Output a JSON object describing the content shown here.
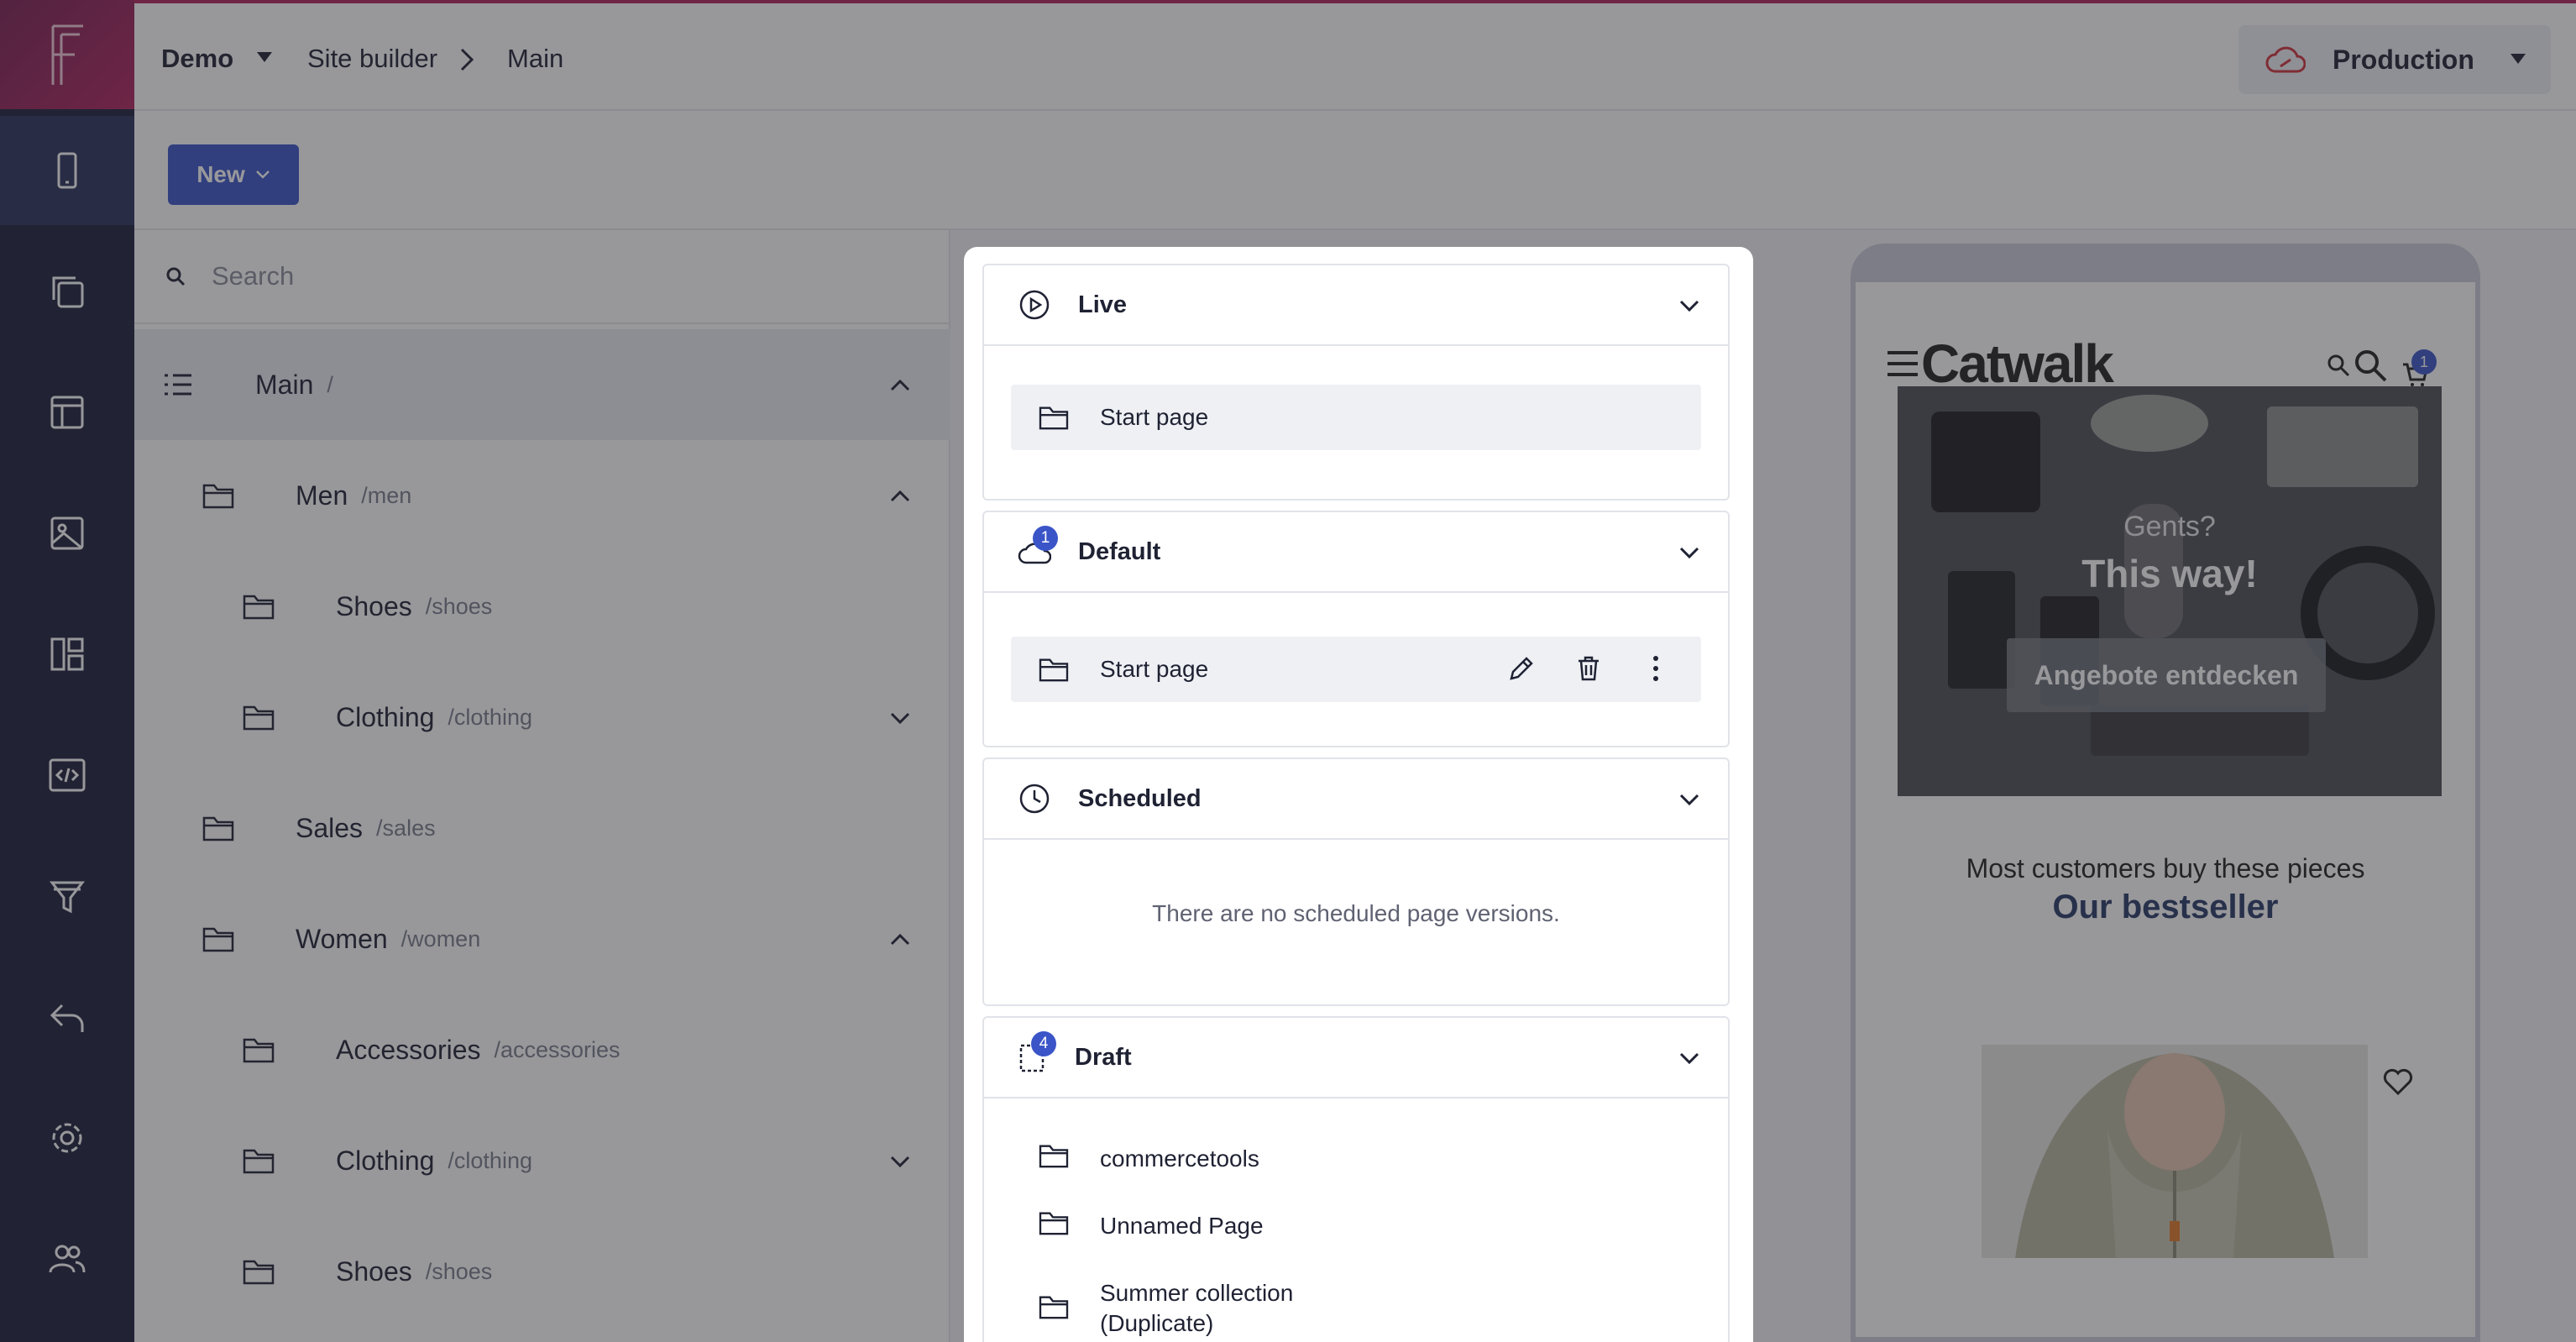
{
  "topbar": {
    "project": "Demo",
    "section": "Site builder",
    "page": "Main",
    "environment": "Production"
  },
  "toolbar": {
    "new_label": "New"
  },
  "sidebar": {
    "search_placeholder": "Search",
    "tree": [
      {
        "name": "Main",
        "path": "/"
      },
      {
        "name": "Men",
        "path": "/men"
      },
      {
        "name": "Shoes",
        "path": "/shoes"
      },
      {
        "name": "Clothing",
        "path": "/clothing"
      },
      {
        "name": "Sales",
        "path": "/sales"
      },
      {
        "name": "Women",
        "path": "/women"
      },
      {
        "name": "Accessories",
        "path": "/accessories"
      },
      {
        "name": "Clothing",
        "path": "/clothing"
      },
      {
        "name": "Shoes",
        "path": "/shoes"
      }
    ]
  },
  "modal": {
    "live": {
      "title": "Live",
      "items": [
        "Start page"
      ]
    },
    "default": {
      "title": "Default",
      "badge": "1",
      "items": [
        "Start page"
      ]
    },
    "scheduled": {
      "title": "Scheduled",
      "empty": "There are no scheduled page versions."
    },
    "draft": {
      "title": "Draft",
      "badge": "4",
      "items": [
        "commercetools",
        "Unnamed Page",
        "Summer collection",
        "(Duplicate)"
      ]
    }
  },
  "preview": {
    "brand": "Catwalk",
    "cart_count": "1",
    "hero_sub": "Gents?",
    "hero_title": "This way!",
    "hero_button": "Angebote entdecken",
    "best_sub": "Most customers buy these pieces",
    "best_title": "Our bestseller"
  },
  "colors": {
    "accent": "#3b55c8",
    "brand": "#b0235d",
    "rail": "#1b1f3b"
  }
}
